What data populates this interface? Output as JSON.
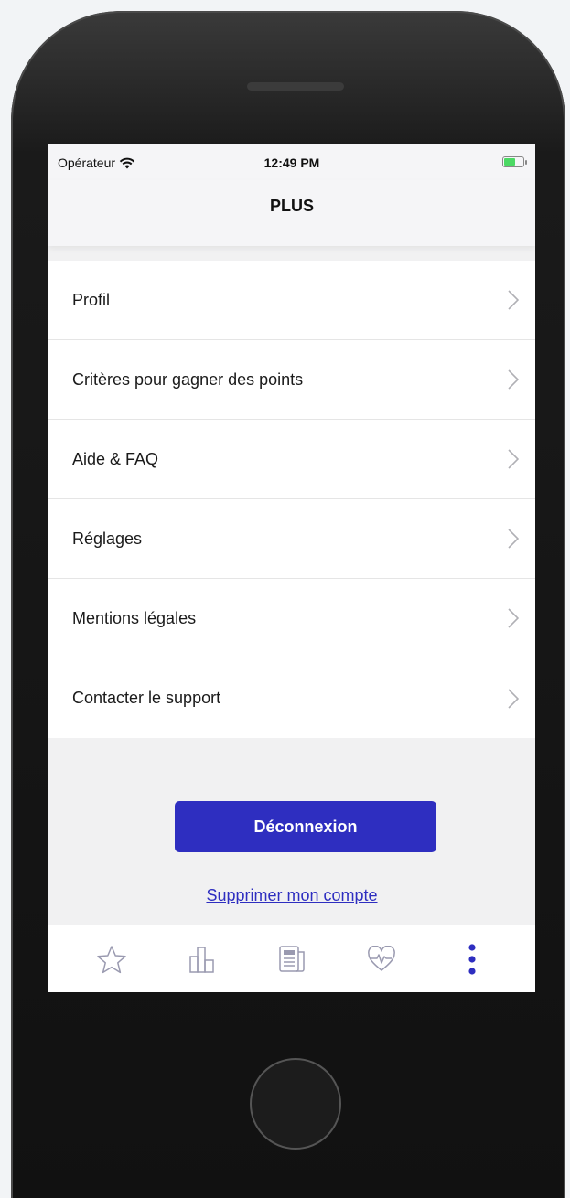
{
  "status_bar": {
    "carrier": "Opérateur",
    "time": "12:49 PM"
  },
  "nav": {
    "title": "PLUS"
  },
  "menu": {
    "items": [
      {
        "label": "Profil"
      },
      {
        "label": "Critères pour gagner des points"
      },
      {
        "label": "Aide & FAQ"
      },
      {
        "label": "Réglages"
      },
      {
        "label": "Mentions légales"
      },
      {
        "label": "Contacter le support"
      }
    ]
  },
  "actions": {
    "logout_label": "Déconnexion",
    "delete_label": "Supprimer mon compte"
  },
  "tabs": [
    {
      "icon": "star-icon"
    },
    {
      "icon": "bar-chart-icon"
    },
    {
      "icon": "news-icon"
    },
    {
      "icon": "heart-pulse-icon"
    },
    {
      "icon": "more-vertical-icon",
      "active": true
    }
  ],
  "colors": {
    "accent": "#2e2ec0",
    "inactive_icon": "#9a9ab0",
    "battery": "#4cd964"
  }
}
